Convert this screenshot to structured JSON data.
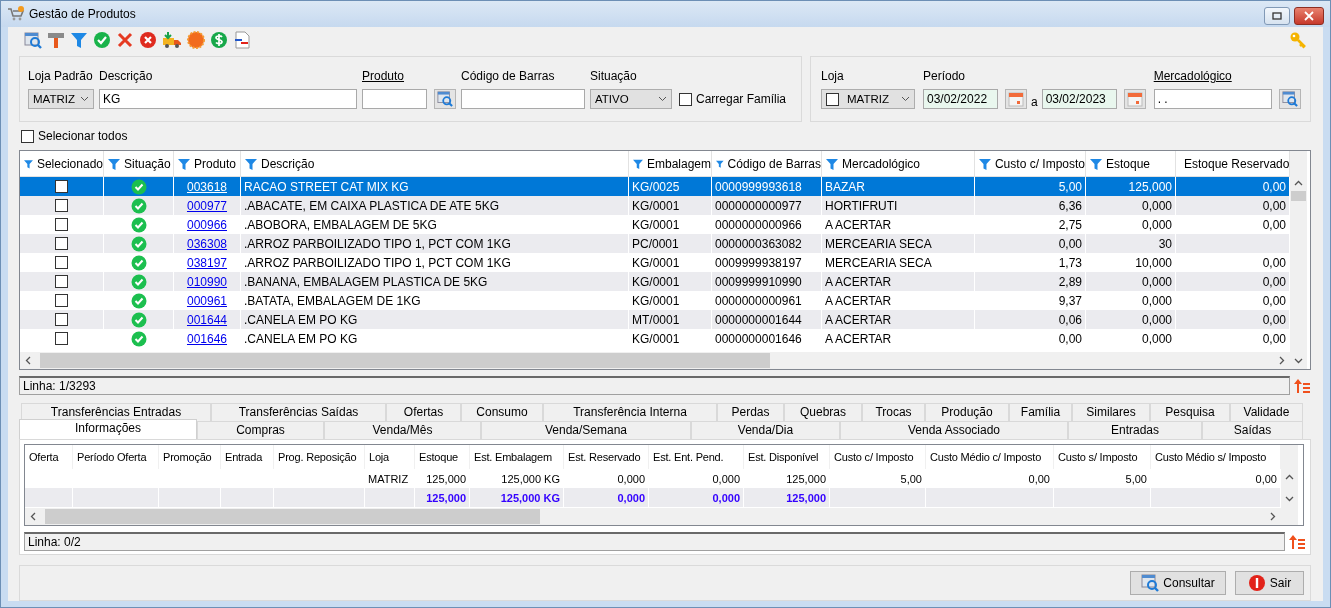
{
  "window": {
    "title": "Gestão de Produtos"
  },
  "filters": {
    "loja_padrao": {
      "label": "Loja Padrão",
      "value": "MATRIZ"
    },
    "descricao": {
      "label": "Descrição",
      "value": "KG"
    },
    "produto": {
      "label": "Produto"
    },
    "codigo_barras": {
      "label": "Código de Barras"
    },
    "situacao": {
      "label": "Situação",
      "value": "ATIVO"
    },
    "carregar_familia": {
      "label": "Carregar Família",
      "checked": false
    }
  },
  "right_filters": {
    "loja": {
      "label": "Loja",
      "value": "MATRIZ",
      "checked": false
    },
    "periodo": {
      "label": "Período",
      "from": "03/02/2022",
      "separator": "a",
      "to": "03/02/2023"
    },
    "mercadologico": {
      "label": "Mercadológico",
      "value": ". ."
    }
  },
  "select_all": {
    "label": "Selecionar todos",
    "checked": false
  },
  "table": {
    "columns": [
      "Selecionado",
      "Situação",
      "Produto",
      "Descrição",
      "Embalagem",
      "Código de Barras",
      "Mercadológico",
      "Custo c/ Imposto",
      "Estoque",
      "Estoque Reservado"
    ],
    "rows": [
      {
        "selected": true,
        "checked": false,
        "active": true,
        "produto": "003618",
        "descricao": "RACAO STREET CAT MIX KG",
        "embalagem": "KG/0025",
        "codigo_barras": "0000999993618",
        "mercadologico": "BAZAR",
        "custo": "5,00",
        "estoque": "125,000",
        "estoque_reservado": "0,00"
      },
      {
        "selected": false,
        "checked": false,
        "active": true,
        "produto": "000977",
        "descricao": ".ABACATE, EM CAIXA PLASTICA DE ATE 5KG",
        "embalagem": "KG/0001",
        "codigo_barras": "0000000000977",
        "mercadologico": "HORTIFRUTI",
        "custo": "6,36",
        "estoque": "0,000",
        "estoque_reservado": "0,00"
      },
      {
        "selected": false,
        "checked": false,
        "active": true,
        "produto": "000966",
        "descricao": ".ABOBORA, EMBALAGEM DE 5KG",
        "embalagem": "KG/0001",
        "codigo_barras": "0000000000966",
        "mercadologico": "A ACERTAR",
        "custo": "2,75",
        "estoque": "0,000",
        "estoque_reservado": "0,00"
      },
      {
        "selected": false,
        "checked": false,
        "active": true,
        "produto": "036308",
        "descricao": ".ARROZ PARBOILIZADO TIPO 1, PCT COM 1KG",
        "embalagem": "PC/0001",
        "codigo_barras": "0000000363082",
        "mercadologico": "MERCEARIA SECA",
        "custo": "0,00",
        "estoque": "30"
      },
      {
        "selected": false,
        "checked": false,
        "active": true,
        "produto": "038197",
        "descricao": ".ARROZ PARBOILIZADO TIPO 1, PCT COM 1KG",
        "embalagem": "KG/0001",
        "codigo_barras": "0009999938197",
        "mercadologico": "MERCEARIA SECA",
        "custo": "1,73",
        "estoque": "10,000",
        "estoque_reservado": "0,00"
      },
      {
        "selected": false,
        "checked": false,
        "active": true,
        "produto": "010990",
        "descricao": ".BANANA, EMBALAGEM PLASTICA DE 5KG",
        "embalagem": "KG/0001",
        "codigo_barras": "0009999910990",
        "mercadologico": "A ACERTAR",
        "custo": "2,89",
        "estoque": "0,000",
        "estoque_reservado": "0,00"
      },
      {
        "selected": false,
        "checked": false,
        "active": true,
        "produto": "000961",
        "descricao": ".BATATA, EMBALAGEM DE 1KG",
        "embalagem": "KG/0001",
        "codigo_barras": "0000000000961",
        "mercadologico": "A ACERTAR",
        "custo": "9,37",
        "estoque": "0,000",
        "estoque_reservado": "0,00"
      },
      {
        "selected": false,
        "checked": false,
        "active": true,
        "produto": "001644",
        "descricao": ".CANELA EM PO KG",
        "embalagem": "MT/0001",
        "codigo_barras": "0000000001644",
        "mercadologico": "A ACERTAR",
        "custo": "0,06",
        "estoque": "0,000",
        "estoque_reservado": "0,00"
      },
      {
        "selected": false,
        "checked": false,
        "active": true,
        "produto": "001646",
        "descricao": ".CANELA EM PO KG",
        "embalagem": "KG/0001",
        "codigo_barras": "0000000001646",
        "mercadologico": "A ACERTAR",
        "custo": "0,00",
        "estoque": "0,000",
        "estoque_reservado": "0,00"
      }
    ]
  },
  "status": "Linha: 1/3293",
  "detail_tabs": {
    "back": [
      {
        "label": "Transferências Entradas",
        "selected": false
      },
      {
        "label": "Transferências Saídas",
        "selected": false
      },
      {
        "label": "Ofertas",
        "selected": false
      },
      {
        "label": "Consumo",
        "selected": false
      },
      {
        "label": "Transferência Interna",
        "selected": false
      },
      {
        "label": "Perdas",
        "selected": false
      },
      {
        "label": "Quebras",
        "selected": false
      },
      {
        "label": "Trocas",
        "selected": false
      },
      {
        "label": "Produção",
        "selected": false
      },
      {
        "label": "Família",
        "selected": false
      },
      {
        "label": "Similares",
        "selected": false
      },
      {
        "label": "Pesquisa",
        "selected": false
      },
      {
        "label": "Validade",
        "selected": false
      }
    ],
    "front": [
      {
        "label": "Informações",
        "selected": true
      },
      {
        "label": "Compras",
        "selected": false
      },
      {
        "label": "Venda/Mês",
        "selected": false
      },
      {
        "label": "Venda/Semana",
        "selected": false
      },
      {
        "label": "Venda/Dia",
        "selected": false
      },
      {
        "label": "Venda Associado",
        "selected": false
      },
      {
        "label": "Entradas",
        "selected": false
      },
      {
        "label": "Saídas",
        "selected": false
      }
    ]
  },
  "detail_table": {
    "columns": [
      "Oferta",
      "Período Oferta",
      "Promoção",
      "Entrada",
      "Prog. Reposição",
      "Loja",
      "Estoque",
      "Est. Embalagem",
      "Est. Reservado",
      "Est. Ent. Pend.",
      "Est. Disponível",
      "Custo c/ Imposto",
      "Custo Médio c/ Imposto",
      "Custo s/ Imposto",
      "Custo Médio s/ Imposto"
    ],
    "rows": [
      {
        "kind": "data",
        "cells": [
          null,
          null,
          null,
          null,
          null,
          "MATRIZ",
          "125,000",
          "125,000 KG",
          "0,000",
          "0,000",
          "125,000",
          "5,00",
          "0,00",
          "5,00",
          "0,00"
        ]
      },
      {
        "kind": "total",
        "cells": [
          null,
          null,
          null,
          null,
          null,
          null,
          "125,000",
          "125,000 KG",
          "0,000",
          "0,000",
          "125,000",
          null,
          null,
          null,
          null
        ]
      }
    ]
  },
  "detail_status": "Linha: 0/2",
  "buttons": [
    {
      "label": "Consultar",
      "kind": "search"
    },
    {
      "label": "Sair",
      "kind": "exit"
    }
  ]
}
